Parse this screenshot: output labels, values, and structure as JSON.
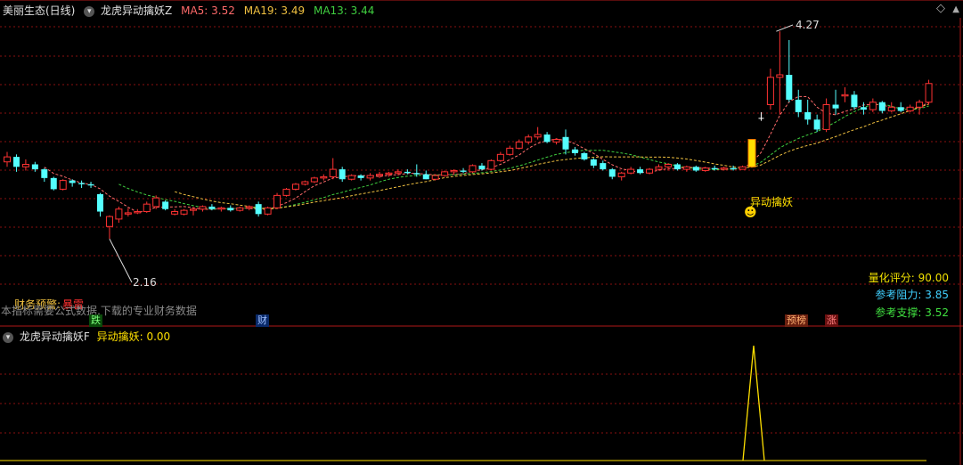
{
  "header": {
    "stock": "美丽生态(日线)",
    "indicator": "龙虎异动擒妖Z",
    "ma5_label": "MA5:",
    "ma5_value": "3.52",
    "ma19_label": "MA19:",
    "ma19_value": "3.49",
    "ma13_label": "MA13:",
    "ma13_value": "3.44"
  },
  "colors": {
    "up": "#ff3232",
    "down": "#54ffff",
    "grid": "#8a1010",
    "ma5": "#ff6a6a",
    "ma19": "#f0c040",
    "ma13": "#40d040",
    "signal": "#ffe000"
  },
  "annotations": {
    "high_price": "4.27",
    "low_price": "2.16",
    "signal_label": "异动擒妖",
    "finance_warning": "财务预警:",
    "finance_warning_value": "暴雷",
    "finance_note": "本指标需要公式数据,下载的专业财务数据"
  },
  "tags": {
    "die": "跌",
    "cai": "财",
    "yubang": "预榜",
    "zhang": "涨"
  },
  "info": {
    "score_label": "量化评分:",
    "score_value": "90.00",
    "resist_label": "参考阻力:",
    "resist_value": "3.85",
    "support_label": "参考支撑:",
    "support_value": "3.52"
  },
  "lower_panel": {
    "indicator": "龙虎异动擒妖F",
    "label": "异动擒妖:",
    "value": "0.00"
  },
  "chart_data": {
    "type": "candlestick",
    "candles": [
      [
        3.22,
        3.3,
        3.18,
        3.26
      ],
      [
        3.26,
        3.28,
        3.14,
        3.18
      ],
      [
        3.18,
        3.24,
        3.15,
        3.2
      ],
      [
        3.2,
        3.22,
        3.14,
        3.16
      ],
      [
        3.16,
        3.17,
        3.06,
        3.09
      ],
      [
        3.09,
        3.1,
        2.99,
        3.0
      ],
      [
        3.0,
        3.08,
        2.99,
        3.07
      ],
      [
        3.07,
        3.08,
        3.02,
        3.05
      ],
      [
        3.05,
        3.07,
        3.01,
        3.04
      ],
      [
        3.04,
        3.06,
        3.01,
        3.03
      ],
      [
        2.96,
        2.97,
        2.78,
        2.82
      ],
      [
        2.7,
        2.79,
        2.6,
        2.78
      ],
      [
        2.76,
        2.86,
        2.73,
        2.84
      ],
      [
        2.8,
        2.85,
        2.78,
        2.81
      ],
      [
        2.81,
        2.84,
        2.8,
        2.82
      ],
      [
        2.82,
        2.9,
        2.81,
        2.88
      ],
      [
        2.86,
        2.95,
        2.84,
        2.93
      ],
      [
        2.9,
        2.91,
        2.83,
        2.84
      ],
      [
        2.8,
        2.84,
        2.79,
        2.82
      ],
      [
        2.8,
        2.84,
        2.79,
        2.83
      ],
      [
        2.83,
        2.85,
        2.79,
        2.84
      ],
      [
        2.84,
        2.87,
        2.82,
        2.86
      ],
      [
        2.86,
        2.88,
        2.83,
        2.84
      ],
      [
        2.84,
        2.86,
        2.82,
        2.85
      ],
      [
        2.85,
        2.87,
        2.82,
        2.83
      ],
      [
        2.83,
        2.86,
        2.82,
        2.85
      ],
      [
        2.85,
        2.87,
        2.83,
        2.86
      ],
      [
        2.88,
        2.9,
        2.78,
        2.8
      ],
      [
        2.8,
        2.86,
        2.79,
        2.85
      ],
      [
        2.85,
        2.97,
        2.84,
        2.95
      ],
      [
        2.95,
        3.01,
        2.94,
        3.0
      ],
      [
        3.0,
        3.05,
        2.99,
        3.04
      ],
      [
        3.04,
        3.07,
        3.03,
        3.06
      ],
      [
        3.06,
        3.1,
        3.05,
        3.09
      ],
      [
        3.09,
        3.12,
        3.07,
        3.1
      ],
      [
        3.1,
        3.25,
        3.08,
        3.16
      ],
      [
        3.16,
        3.18,
        3.06,
        3.08
      ],
      [
        3.08,
        3.12,
        3.07,
        3.11
      ],
      [
        3.11,
        3.12,
        3.07,
        3.09
      ],
      [
        3.09,
        3.13,
        3.07,
        3.11
      ],
      [
        3.11,
        3.14,
        3.09,
        3.12
      ],
      [
        3.12,
        3.14,
        3.1,
        3.13
      ],
      [
        3.13,
        3.16,
        3.11,
        3.14
      ],
      [
        3.14,
        3.16,
        3.12,
        3.13
      ],
      [
        3.13,
        3.2,
        3.1,
        3.12
      ],
      [
        3.12,
        3.15,
        3.08,
        3.08
      ],
      [
        3.08,
        3.12,
        3.07,
        3.11
      ],
      [
        3.11,
        3.15,
        3.1,
        3.14
      ],
      [
        3.14,
        3.16,
        3.12,
        3.15
      ],
      [
        3.15,
        3.17,
        3.13,
        3.14
      ],
      [
        3.14,
        3.2,
        3.13,
        3.19
      ],
      [
        3.19,
        3.21,
        3.15,
        3.16
      ],
      [
        3.16,
        3.24,
        3.15,
        3.23
      ],
      [
        3.23,
        3.3,
        3.22,
        3.28
      ],
      [
        3.28,
        3.35,
        3.27,
        3.33
      ],
      [
        3.33,
        3.4,
        3.32,
        3.38
      ],
      [
        3.38,
        3.44,
        3.36,
        3.42
      ],
      [
        3.42,
        3.5,
        3.4,
        3.44
      ],
      [
        3.44,
        3.46,
        3.37,
        3.38
      ],
      [
        3.38,
        3.41,
        3.36,
        3.4
      ],
      [
        3.42,
        3.48,
        3.28,
        3.32
      ],
      [
        3.32,
        3.34,
        3.27,
        3.29
      ],
      [
        3.29,
        3.3,
        3.23,
        3.24
      ],
      [
        3.24,
        3.25,
        3.17,
        3.19
      ],
      [
        3.21,
        3.23,
        3.15,
        3.16
      ],
      [
        3.16,
        3.17,
        3.08,
        3.1
      ],
      [
        3.1,
        3.14,
        3.07,
        3.13
      ],
      [
        3.13,
        3.18,
        3.12,
        3.16
      ],
      [
        3.16,
        3.18,
        3.12,
        3.13
      ],
      [
        3.13,
        3.17,
        3.12,
        3.16
      ],
      [
        3.16,
        3.2,
        3.15,
        3.18
      ],
      [
        3.18,
        3.21,
        3.15,
        3.2
      ],
      [
        3.2,
        3.21,
        3.15,
        3.16
      ],
      [
        3.16,
        3.19,
        3.14,
        3.18
      ],
      [
        3.18,
        3.19,
        3.14,
        3.15
      ],
      [
        3.15,
        3.18,
        3.14,
        3.17
      ],
      [
        3.17,
        3.19,
        3.15,
        3.16
      ],
      [
        3.16,
        3.18,
        3.15,
        3.17
      ],
      [
        3.17,
        3.19,
        3.15,
        3.16
      ],
      [
        3.16,
        3.19,
        3.16,
        3.18
      ],
      [
        3.18,
        3.4,
        3.18,
        3.4
      ],
      [
        3.58,
        3.62,
        3.55,
        3.57
      ],
      [
        3.68,
        3.97,
        3.64,
        3.9
      ],
      [
        3.9,
        4.27,
        3.6,
        3.92
      ],
      [
        3.92,
        4.2,
        3.7,
        3.72
      ],
      [
        3.72,
        3.8,
        3.58,
        3.62
      ],
      [
        3.62,
        3.72,
        3.52,
        3.56
      ],
      [
        3.56,
        3.6,
        3.46,
        3.48
      ],
      [
        3.48,
        3.73,
        3.46,
        3.68
      ],
      [
        3.68,
        3.8,
        3.6,
        3.65
      ],
      [
        3.75,
        3.82,
        3.7,
        3.76
      ],
      [
        3.76,
        3.79,
        3.64,
        3.66
      ],
      [
        3.66,
        3.7,
        3.6,
        3.64
      ],
      [
        3.64,
        3.73,
        3.62,
        3.7
      ],
      [
        3.7,
        3.71,
        3.61,
        3.63
      ],
      [
        3.63,
        3.7,
        3.62,
        3.66
      ],
      [
        3.66,
        3.7,
        3.62,
        3.63
      ],
      [
        3.63,
        3.68,
        3.62,
        3.66
      ],
      [
        3.66,
        3.72,
        3.6,
        3.7
      ],
      [
        3.7,
        3.88,
        3.68,
        3.85
      ]
    ],
    "special": [
      {
        "index": 80,
        "kind": "signal_bar"
      },
      {
        "index": 81,
        "kind": "dash"
      }
    ],
    "ma_periods": {
      "ma5": 5,
      "ma19": 19,
      "ma13": 13
    },
    "lower_series": {
      "signal_index": 80,
      "peak_value": 1,
      "baseline": 0
    }
  }
}
